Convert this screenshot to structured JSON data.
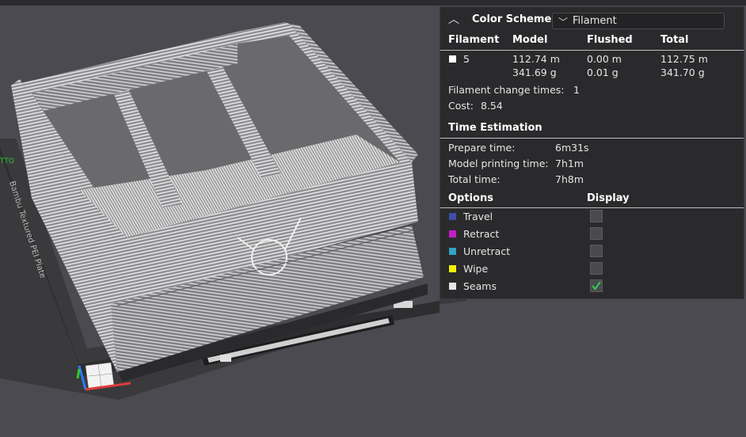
{
  "color_scheme": {
    "title": "Color Scheme",
    "collapse_icon": "chevron-up-icon",
    "selected": "Filament",
    "dropdown_icon": "chevron-down-icon"
  },
  "filament_table": {
    "headers": [
      "Filament",
      "Model",
      "Flushed",
      "Total"
    ],
    "row": {
      "swatch_color": "#ffffff",
      "id": "5",
      "model_length": "112.74 m",
      "model_weight": "341.69 g",
      "flushed_length": "0.00 m",
      "flushed_weight": "0.01 g",
      "total_length": "112.75 m",
      "total_weight": "341.70 g"
    },
    "change_times_label": "Filament change times:",
    "change_times_value": "1",
    "cost_label": "Cost:",
    "cost_value": "8.54"
  },
  "time_estimation": {
    "title": "Time Estimation",
    "rows": [
      {
        "label": "Prepare time:",
        "value": "6m31s"
      },
      {
        "label": "Model printing time:",
        "value": "7h1m"
      },
      {
        "label": "Total time:",
        "value": "7h8m"
      }
    ]
  },
  "options": {
    "headers": [
      "Options",
      "Display"
    ],
    "items": [
      {
        "label": "Travel",
        "color": "#3b4fa6",
        "checked": false
      },
      {
        "label": "Retract",
        "color": "#c31fc3",
        "checked": false
      },
      {
        "label": "Unretract",
        "color": "#33a3c7",
        "checked": false
      },
      {
        "label": "Wipe",
        "color": "#f2f200",
        "checked": false
      },
      {
        "label": "Seams",
        "color": "#e6e6e6",
        "checked": true
      }
    ]
  },
  "viewport": {
    "plate_label": "Bambu Textured PEI Plate",
    "axis_colors": {
      "x": "#e03a3a",
      "y": "#2ecc2e",
      "z": "#2b7bff"
    }
  },
  "colors": {
    "panel_bg": "#2a2a2c",
    "viewport_bg": "#4b4a50",
    "check_green": "#2ecc5a"
  }
}
